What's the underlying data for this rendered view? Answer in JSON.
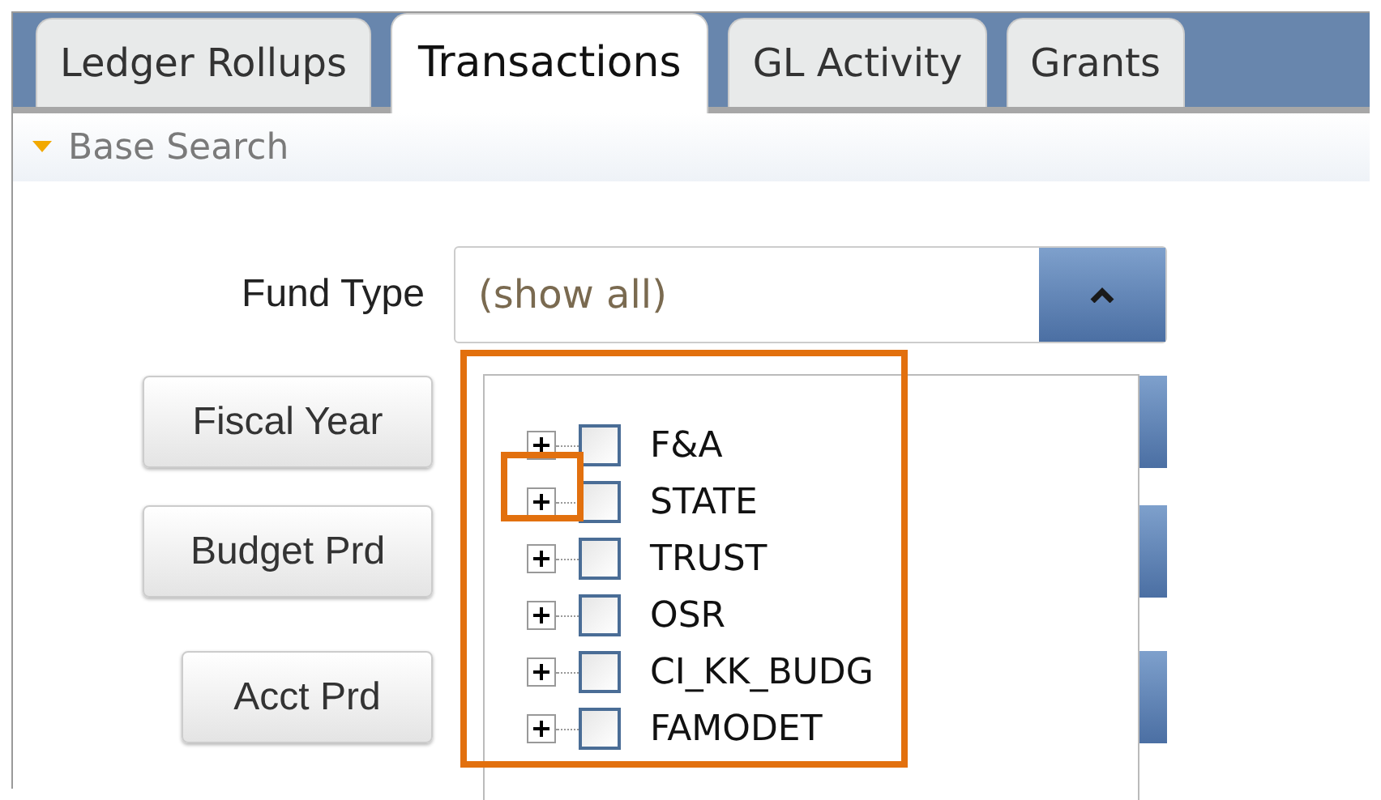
{
  "tabs": [
    {
      "label": "Ledger Rollups",
      "selected": false
    },
    {
      "label": "Transactions",
      "selected": true
    },
    {
      "label": "GL Activity",
      "selected": false
    },
    {
      "label": "Grants",
      "selected": false
    }
  ],
  "section": {
    "title": "Base Search",
    "expanded": true
  },
  "fund_type": {
    "label": "Fund Type",
    "value": "(show all)",
    "open": true,
    "options": [
      {
        "label": "F&A",
        "expanded": false,
        "checked": false
      },
      {
        "label": "STATE",
        "expanded": false,
        "checked": false
      },
      {
        "label": "TRUST",
        "expanded": false,
        "checked": false
      },
      {
        "label": "OSR",
        "expanded": false,
        "checked": false
      },
      {
        "label": "CI_KK_BUDG",
        "expanded": false,
        "checked": false
      },
      {
        "label": "FAMODET",
        "expanded": false,
        "checked": false
      }
    ]
  },
  "buttons": [
    {
      "label": "Fiscal Year"
    },
    {
      "label": "Budget Prd"
    },
    {
      "label": "Acct Prd"
    }
  ]
}
